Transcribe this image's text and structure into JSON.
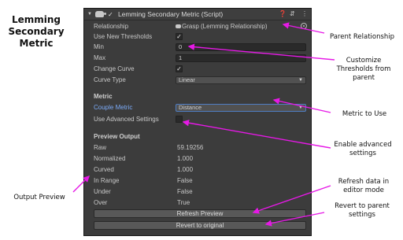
{
  "caption": {
    "line1": "Lemming",
    "line2": "Secondary",
    "line3": "Metric"
  },
  "component": {
    "title": "Lemming Secondary Metric (Script)",
    "enabled": "✓"
  },
  "properties": {
    "relationship_label": "Relationship",
    "relationship_value": "Grasp (Lemming Relationship)",
    "use_new_thresholds_label": "Use New Thresholds",
    "use_new_thresholds_checked": "✓",
    "min_label": "Min",
    "min_value": "0",
    "max_label": "Max",
    "max_value": "1",
    "change_curve_label": "Change Curve",
    "change_curve_checked": "✓",
    "curve_type_label": "Curve Type",
    "curve_type_value": "Linear"
  },
  "metric": {
    "section_label": "Metric",
    "couple_metric_label": "Couple Metric",
    "couple_metric_value": "Distance",
    "advanced_label": "Use Advanced Settings"
  },
  "preview": {
    "section_label": "Preview Output",
    "rows": [
      {
        "label": "Raw",
        "value": "59.19256"
      },
      {
        "label": "Normalized",
        "value": "1.000"
      },
      {
        "label": "Curved",
        "value": "1.000"
      },
      {
        "label": "In Range",
        "value": "False"
      },
      {
        "label": "Under",
        "value": "False"
      },
      {
        "label": "Over",
        "value": "True"
      }
    ]
  },
  "buttons": {
    "refresh": "Refresh Preview",
    "revert": "Revert to original"
  },
  "annotations": {
    "parent_relationship": "Parent Relationship",
    "customize_1": "Customize",
    "customize_2": "Thresholds from",
    "customize_3": "parent",
    "metric_to_use": "Metric to Use",
    "enable_1": "Enable advanced",
    "enable_2": "settings",
    "refresh_1": "Refresh data in",
    "refresh_2": "editor mode",
    "revert_1": "Revert to parent",
    "revert_2": "settings",
    "output_preview": "Output Preview"
  },
  "colors": {
    "panel": "#3c3c3c",
    "arrow": "#e619e6",
    "accent": "#7baaf7"
  }
}
